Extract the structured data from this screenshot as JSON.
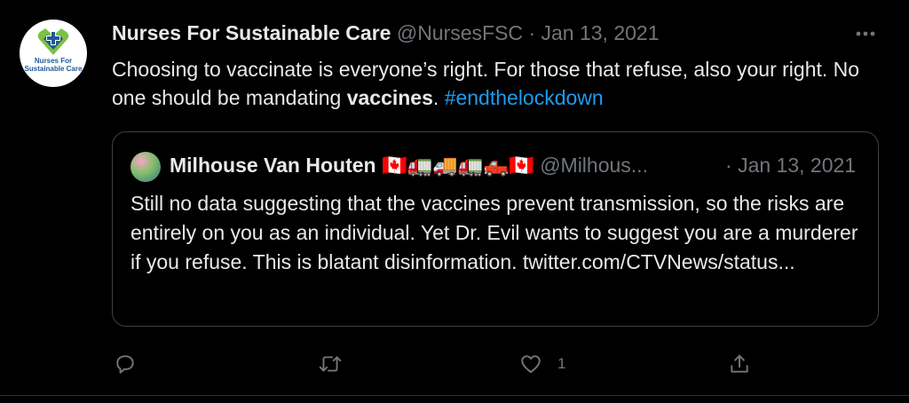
{
  "tweet": {
    "author_name": "Nurses For Sustainable Care",
    "handle": "@NursesFSC",
    "separator": "·",
    "date": "Jan 13, 2021",
    "avatar_text": "Nurses For Sustainable Care",
    "text_part1": "Choosing to vaccinate is everyone’s right. For those that refuse, also your right. No one should be mandating ",
    "text_bold": "vaccines",
    "text_part2": ". ",
    "hashtag": "#endthelockdown",
    "more_icon": "ellipsis-icon"
  },
  "quoted_tweet": {
    "author_name": "Milhouse Van Houten",
    "name_emoji": "🇨🇦🚛🚚🚛🛻🇨🇦",
    "handle": "@Milhous...",
    "separator": "·",
    "date": "Jan 13, 2021",
    "text": "Still no data suggesting that the vaccines prevent transmission, so the risks are entirely on you as an individual. Yet Dr. Evil wants to suggest you are a murderer if you refuse. This is blatant disinformation. twitter.com/CTVNews/status..."
  },
  "actions": {
    "reply_icon": "reply-icon",
    "retweet_icon": "retweet-icon",
    "like_icon": "heart-icon",
    "like_count": "1",
    "share_icon": "share-icon"
  },
  "colors": {
    "background": "#000000",
    "text": "#e7e9ea",
    "muted": "#71767b",
    "link": "#1d9bf0",
    "border": "#3e4144"
  }
}
